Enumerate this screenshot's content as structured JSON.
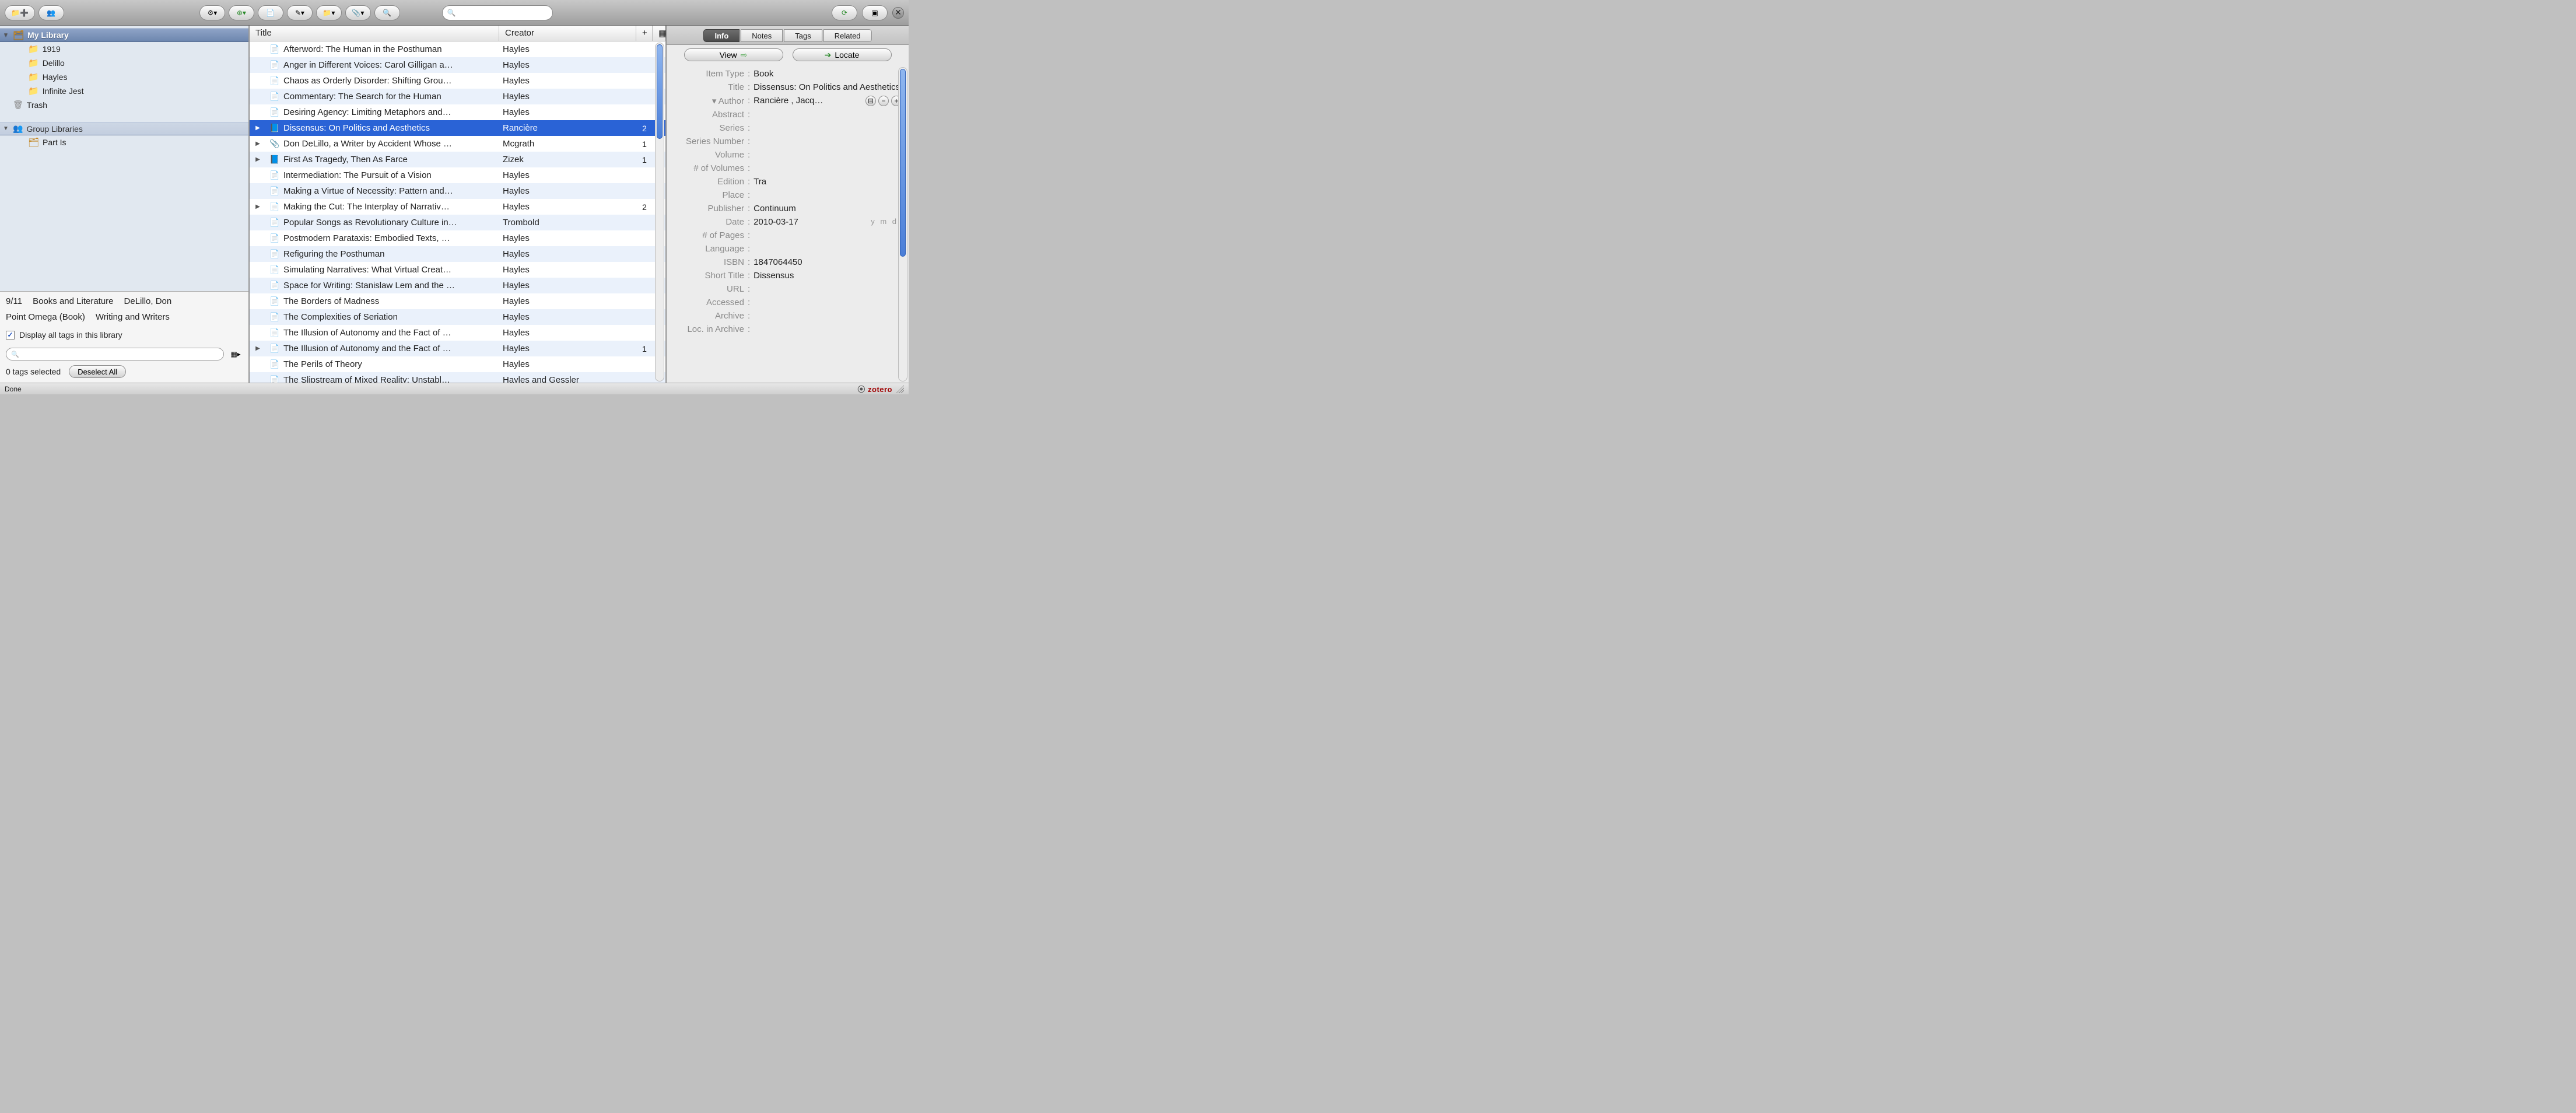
{
  "toolbar": {
    "search_placeholder": ""
  },
  "library_tree": {
    "root_label": "My Library",
    "collections": [
      {
        "label": "1919"
      },
      {
        "label": "Delillo"
      },
      {
        "label": "Hayles"
      },
      {
        "label": "Infinite Jest"
      }
    ],
    "trash_label": "Trash",
    "group_heading": "Group Libraries",
    "groups": [
      {
        "label": "Part Is"
      }
    ]
  },
  "tag_panel": {
    "tags": [
      "9/11",
      "Books and Literature",
      "DeLillo, Don",
      "Point Omega (Book)",
      "Writing and Writers"
    ],
    "display_all_label": "Display all tags in this library",
    "tags_selected_label": "0 tags selected",
    "deselect_label": "Deselect All"
  },
  "columns": {
    "title": "Title",
    "creator": "Creator",
    "attach": "+"
  },
  "items": [
    {
      "expand": false,
      "icon": "doc",
      "title": "Afterword: The Human in the Posthuman",
      "creator": "Hayles",
      "att": "",
      "selected": false
    },
    {
      "expand": false,
      "icon": "doc",
      "title": "Anger in Different Voices: Carol Gilligan a…",
      "creator": "Hayles",
      "att": "",
      "selected": false
    },
    {
      "expand": false,
      "icon": "doc",
      "title": "Chaos as Orderly Disorder: Shifting Grou…",
      "creator": "Hayles",
      "att": "",
      "selected": false
    },
    {
      "expand": false,
      "icon": "doc",
      "title": "Commentary: The Search for the Human",
      "creator": "Hayles",
      "att": "",
      "selected": false
    },
    {
      "expand": false,
      "icon": "doc",
      "title": "Desiring Agency: Limiting Metaphors and…",
      "creator": "Hayles",
      "att": "",
      "selected": false
    },
    {
      "expand": true,
      "icon": "book",
      "title": "Dissensus: On Politics and Aesthetics",
      "creator": "Rancière",
      "att": "2",
      "selected": true
    },
    {
      "expand": true,
      "icon": "clip",
      "title": "Don DeLillo, a Writer by Accident Whose …",
      "creator": "Mcgrath",
      "att": "1",
      "selected": false
    },
    {
      "expand": true,
      "icon": "book",
      "title": "First As Tragedy, Then As Farce",
      "creator": "Zizek",
      "att": "1",
      "selected": false
    },
    {
      "expand": false,
      "icon": "doc",
      "title": "Intermediation: The Pursuit of a Vision",
      "creator": "Hayles",
      "att": "",
      "selected": false
    },
    {
      "expand": false,
      "icon": "doc",
      "title": "Making a Virtue of Necessity: Pattern and…",
      "creator": "Hayles",
      "att": "",
      "selected": false
    },
    {
      "expand": true,
      "icon": "doc",
      "title": "Making the Cut: The Interplay of Narrativ…",
      "creator": "Hayles",
      "att": "2",
      "selected": false
    },
    {
      "expand": false,
      "icon": "doc",
      "title": "Popular Songs as Revolutionary Culture in…",
      "creator": "Trombold",
      "att": "",
      "selected": false
    },
    {
      "expand": false,
      "icon": "doc",
      "title": "Postmodern Parataxis: Embodied Texts, …",
      "creator": "Hayles",
      "att": "",
      "selected": false
    },
    {
      "expand": false,
      "icon": "doc",
      "title": "Refiguring the Posthuman",
      "creator": "Hayles",
      "att": "",
      "selected": false
    },
    {
      "expand": false,
      "icon": "doc",
      "title": "Simulating Narratives: What Virtual Creat…",
      "creator": "Hayles",
      "att": "",
      "selected": false
    },
    {
      "expand": false,
      "icon": "doc",
      "title": "Space for Writing: Stanislaw Lem and the …",
      "creator": "Hayles",
      "att": "",
      "selected": false
    },
    {
      "expand": false,
      "icon": "doc",
      "title": "The Borders of Madness",
      "creator": "Hayles",
      "att": "",
      "selected": false
    },
    {
      "expand": false,
      "icon": "doc",
      "title": "The Complexities of Seriation",
      "creator": "Hayles",
      "att": "",
      "selected": false
    },
    {
      "expand": false,
      "icon": "doc",
      "title": "The Illusion of Autonomy and the Fact of …",
      "creator": "Hayles",
      "att": "",
      "selected": false
    },
    {
      "expand": true,
      "icon": "doc",
      "title": "The Illusion of Autonomy and the Fact of …",
      "creator": "Hayles",
      "att": "1",
      "selected": false
    },
    {
      "expand": false,
      "icon": "doc",
      "title": "The Perils of Theory",
      "creator": "Hayles",
      "att": "",
      "selected": false
    },
    {
      "expand": false,
      "icon": "doc",
      "title": "The Slipstream of Mixed Reality: Unstabl…",
      "creator": "Hayles and Gessler",
      "att": "",
      "selected": false
    }
  ],
  "item_pane": {
    "tabs": [
      "Info",
      "Notes",
      "Tags",
      "Related"
    ],
    "active_tab": "Info",
    "view_label": "View",
    "locate_label": "Locate",
    "fields": {
      "item_type": {
        "label": "Item Type",
        "value": "Book"
      },
      "title": {
        "label": "Title",
        "value": "Dissensus: On Politics and Aesthetics"
      },
      "author": {
        "label": "Author",
        "value": "Rancière  ,  Jacq…"
      },
      "abstract": {
        "label": "Abstract",
        "value": ""
      },
      "series": {
        "label": "Series",
        "value": ""
      },
      "series_no": {
        "label": "Series Number",
        "value": ""
      },
      "volume": {
        "label": "Volume",
        "value": ""
      },
      "num_vol": {
        "label": "# of Volumes",
        "value": ""
      },
      "edition": {
        "label": "Edition",
        "value": "Tra"
      },
      "place": {
        "label": "Place",
        "value": ""
      },
      "publisher": {
        "label": "Publisher",
        "value": "Continuum"
      },
      "date": {
        "label": "Date",
        "value": "2010-03-17",
        "hint": "y m d"
      },
      "pages": {
        "label": "# of Pages",
        "value": ""
      },
      "language": {
        "label": "Language",
        "value": ""
      },
      "isbn": {
        "label": "ISBN",
        "value": "1847064450"
      },
      "short_title": {
        "label": "Short Title",
        "value": "Dissensus"
      },
      "url": {
        "label": "URL",
        "value": ""
      },
      "accessed": {
        "label": "Accessed",
        "value": ""
      },
      "archive": {
        "label": "Archive",
        "value": ""
      },
      "loc_archive": {
        "label": "Loc. in Archive",
        "value": ""
      }
    }
  },
  "status": {
    "text": "Done",
    "brand": "zotero"
  }
}
